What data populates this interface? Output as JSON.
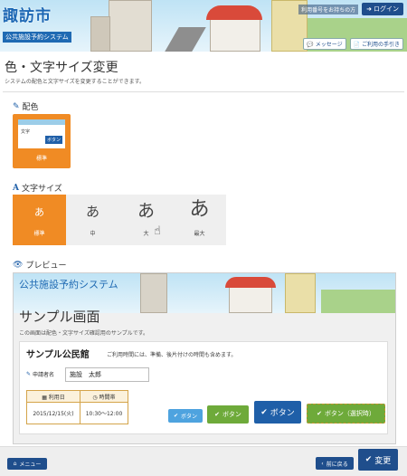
{
  "header": {
    "city": "諏訪市",
    "system": "公共施設予約システム",
    "note": "利用番号をお持ちの方",
    "login": "ログイン",
    "message": "メッセージ",
    "guide": "ご利用の手引き"
  },
  "page": {
    "title": "色・文字サイズ変更",
    "description": "システムの配色と文字サイズを変更することができます。"
  },
  "color_section": {
    "label": "配色",
    "option_label": "標準",
    "thumb_text": "文字",
    "thumb_button": "ボタン"
  },
  "font_section": {
    "label": "文字サイズ",
    "options": [
      {
        "glyph": "あ",
        "label": "標準",
        "selected": true
      },
      {
        "glyph": "あ",
        "label": "中",
        "selected": false
      },
      {
        "glyph": "あ",
        "label": "大",
        "selected": false
      },
      {
        "glyph": "あ",
        "label": "最大",
        "selected": false
      }
    ]
  },
  "preview": {
    "label": "プレビュー",
    "system": "公共施設予約システム",
    "title": "サンプル画面",
    "description": "この画面は配色・文字サイズ確認用のサンプルです。",
    "facility": "サンプル公民館",
    "facility_note": "ご利用時間には、準備、後片付けの時間も含めます。",
    "applicant_label": "申請者名",
    "applicant_value": "施設　太郎",
    "col_date": "利用日",
    "col_time": "時間帯",
    "date": "2015/12/15(火)",
    "time": "10:30～12:00",
    "btn_small": "ボタン",
    "btn_medium": "ボタン",
    "btn_large": "ボタン",
    "btn_selected": "ボタン（選択時）"
  },
  "footer": {
    "menu": "メニュー",
    "back": "前に戻る",
    "change": "変更"
  },
  "colors": {
    "accent": "#f08b24",
    "primary": "#1f4e8c",
    "green": "#6eaa3a"
  }
}
